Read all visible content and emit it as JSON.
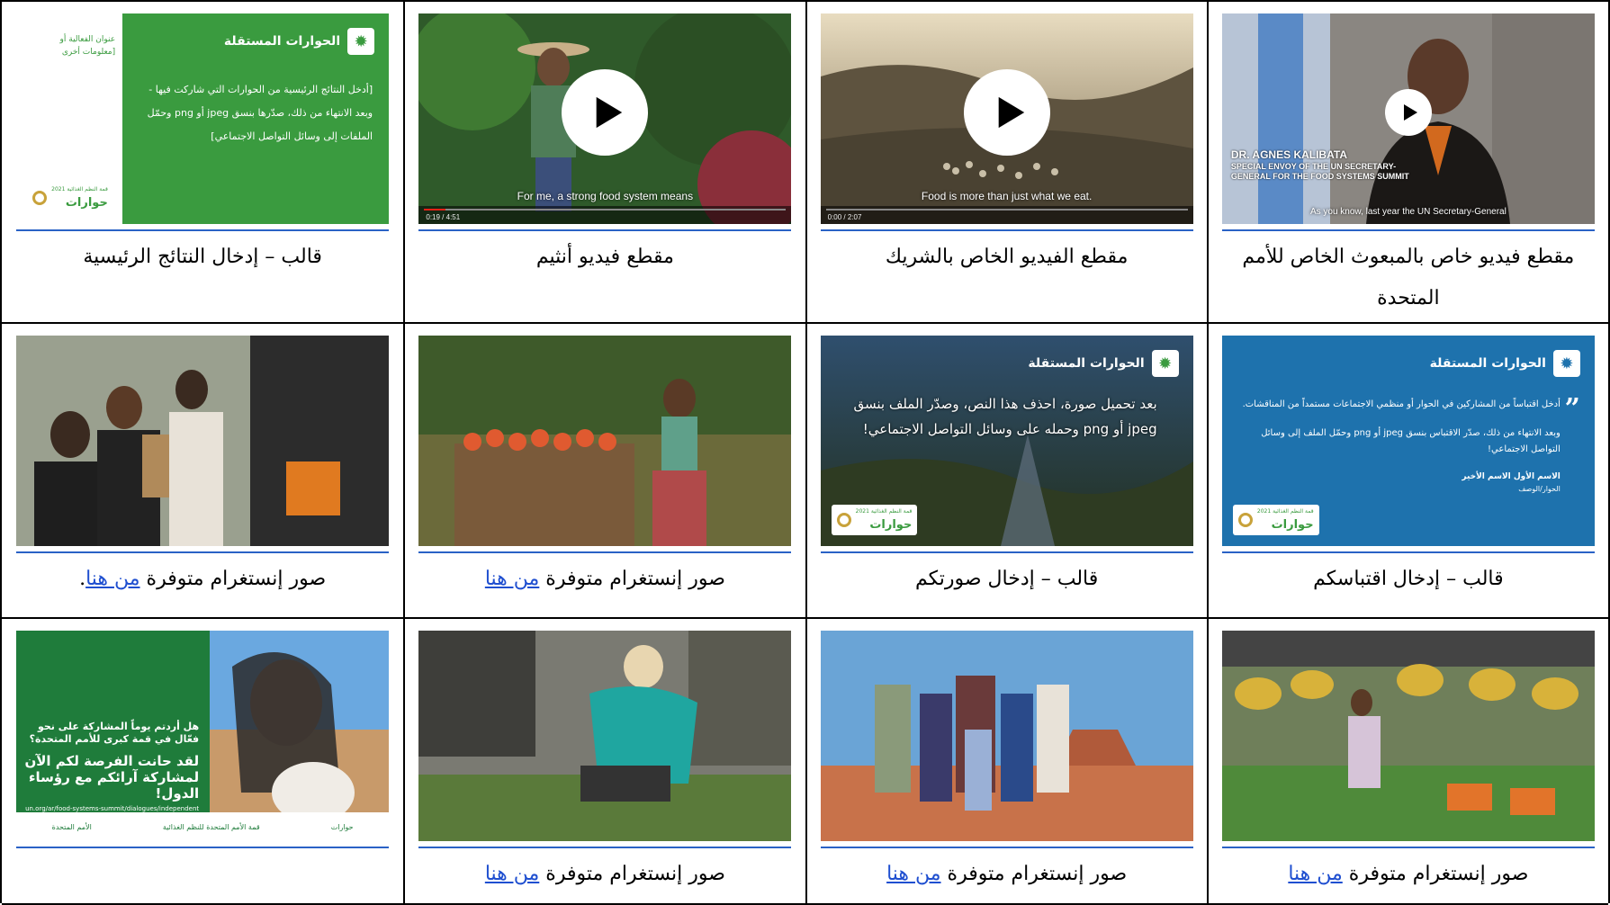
{
  "colors": {
    "link": "#1f4fd0",
    "rule": "#2a62c6",
    "template_green": "#3a9b3f",
    "template_blue": "#1e72ad"
  },
  "rows": [
    [
      {
        "kind": "video-envoy",
        "caption": "مقطع فيديو خاص بالمبعوث الخاص للأمم المتحدة",
        "name_line1": "DR. AGNES KALIBATA",
        "name_line2": "SPECIAL ENVOY OF THE UN SECRETARY-",
        "name_line3": "GENERAL FOR THE FOOD SYSTEMS SUMMIT",
        "subtitle": "As you know, last year the UN Secretary-General"
      },
      {
        "kind": "video",
        "caption": "مقطع الفيديو الخاص بالشريك",
        "subtitle": "Food is more than just what we eat.",
        "time": "0:00 / 2:07",
        "progress": 0.0
      },
      {
        "kind": "video",
        "caption": "مقطع فيديو أنثيم",
        "subtitle": "For me, a strong food system means",
        "time": "0:19 / 4:51",
        "progress": 0.06
      },
      {
        "kind": "template-green",
        "caption": "قالب – إدخال النتائج الرئيسية",
        "title": "الحوارات المستقلة",
        "body": "[أدخل النتائج الرئيسية من الحوارات التي شاركت فيها - وبعد الانتهاء من ذلك، صدّرها بنسق jpeg أو png وحمّل الملفات إلى وسائل التواصل الاجتماعي]",
        "side_note": "عنوان الفعالية أو [معلومات أخرى",
        "logo_text": "حوارات",
        "logo_sub": "قمة النظم الغذائية 2021"
      }
    ],
    [
      {
        "kind": "template-blue",
        "caption": "قالب – إدخال اقتباسكم",
        "title": "الحوارات المستقلة",
        "quote_p1": "أدخل اقتباساً من المشاركين في الحوار أو منظمي الاجتماعات مستمداً من المناقشات.",
        "quote_p2": "وبعد الانتهاء من ذلك، صدّر الاقتباس بنسق jpeg أو png وحمّل الملف إلى وسائل التواصل الاجتماعي!",
        "sig_name": "الاسم الأول الاسم الأخير",
        "sig_role": "الحوار/الوصف",
        "logo_text": "حوارات",
        "logo_sub": "قمة النظم الغذائية 2021"
      },
      {
        "kind": "template-photo",
        "caption": "قالب – إدخال صورتكم",
        "title": "الحوارات المستقلة",
        "body": "بعد تحميل صورة، احذف هذا النص، وصدّر الملف بنسق jpeg أو png وحمله على وسائل التواصل الاجتماعي!",
        "logo_text": "حوارات",
        "logo_sub": "قمة النظم الغذائية 2021"
      },
      {
        "kind": "photo-farmer",
        "caption_text": "صور إنستغرام متوفرة",
        "link": "من هنا",
        "suffix": ""
      },
      {
        "kind": "photo-donation",
        "caption_text": "صور إنستغرام متوفرة",
        "link": "من هنا",
        "suffix": "."
      }
    ],
    [
      {
        "kind": "photo-market",
        "caption_text": "صور إنستغرام متوفرة",
        "link": "من هنا",
        "suffix": ""
      },
      {
        "kind": "photo-family",
        "caption_text": "صور إنستغرام متوفرة",
        "link": "من هنا",
        "suffix": ""
      },
      {
        "kind": "photo-garden",
        "caption_text": "صور إنستغرام متوفرة",
        "link": "من هنا",
        "suffix": ""
      },
      {
        "kind": "promo",
        "question": "هل أردتم يوماً المشاركة على نحو فعّال في قمة كبرى للأمم المتحدة؟",
        "headline": "لقد حانت الفرصة لكم الآن لمشاركة آرائكم مع رؤساء الدول!",
        "url": "un.org/ar/food-systems-summit/dialogues/independent",
        "footer_1": "الأمم المتحدة",
        "footer_2": "قمة الأمم المتحدة للنظم الغذائية",
        "footer_3": "حوارات"
      }
    ]
  ]
}
